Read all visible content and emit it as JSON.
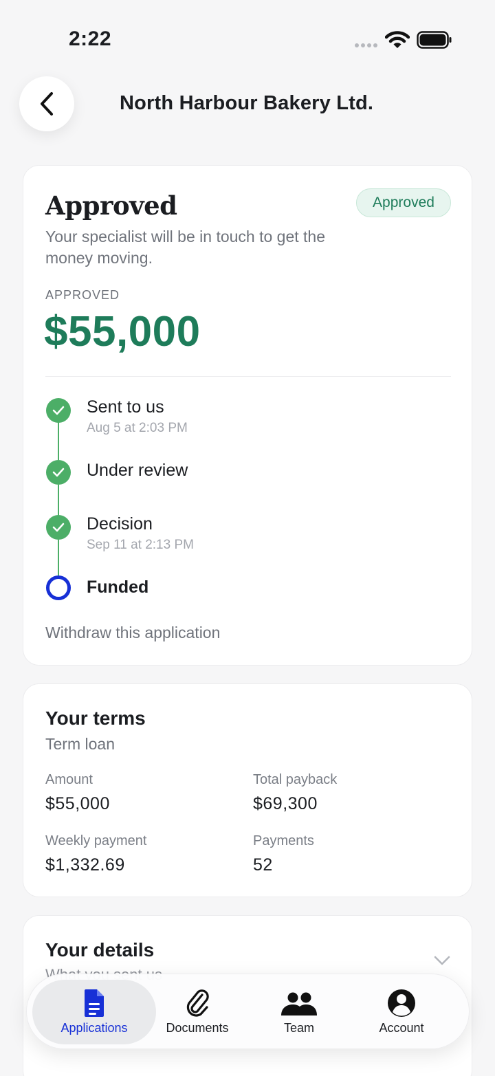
{
  "status_bar": {
    "time": "2:22"
  },
  "header": {
    "title": "North Harbour Bakery Ltd."
  },
  "application": {
    "heading": "Approved",
    "badge": "Approved",
    "description": "Your specialist will be in touch to get the money moving.",
    "amount_label": "APPROVED",
    "amount": "$55,000",
    "steps": [
      {
        "label": "Sent to us",
        "date": "Aug 5 at 2:03 PM",
        "done": true
      },
      {
        "label": "Under review",
        "date": "",
        "done": true
      },
      {
        "label": "Decision",
        "date": "Sep 11 at 2:13 PM",
        "done": true
      },
      {
        "label": "Funded",
        "date": "",
        "done": false
      }
    ],
    "withdraw": "Withdraw this application"
  },
  "terms": {
    "heading": "Your terms",
    "subtitle": "Term loan",
    "amount_label": "Amount",
    "amount_value": "$55,000",
    "total_label": "Total payback",
    "total_value": "$69,300",
    "weekly_label": "Weekly payment",
    "weekly_value": "$1,332.69",
    "payments_label": "Payments",
    "payments_value": "52"
  },
  "details": {
    "heading": "Your details",
    "subtitle": "What you sent us"
  },
  "tabs": [
    {
      "label": "Applications",
      "icon": "document-icon",
      "active": true
    },
    {
      "label": "Documents",
      "icon": "paperclip-icon",
      "active": false
    },
    {
      "label": "Team",
      "icon": "team-icon",
      "active": false
    },
    {
      "label": "Account",
      "icon": "account-icon",
      "active": false
    }
  ],
  "colors": {
    "accent_green": "#1e7c5a",
    "step_green": "#4cae67",
    "active_blue": "#1730d6"
  }
}
